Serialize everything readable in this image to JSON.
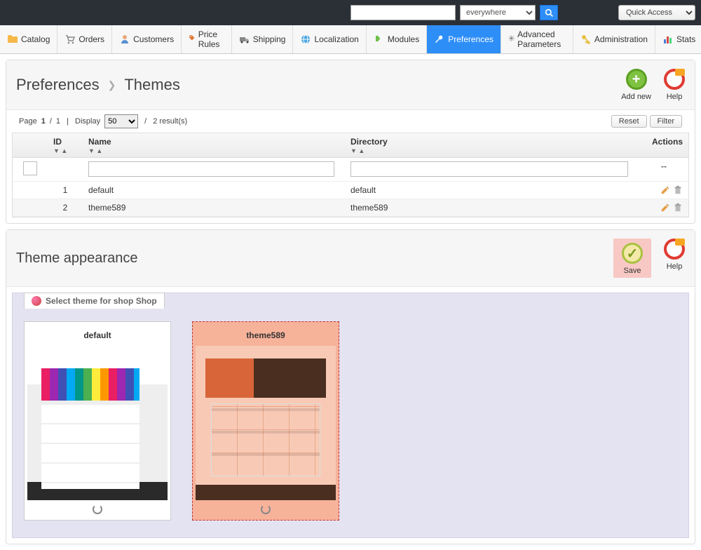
{
  "topbar": {
    "search_value": "",
    "scope_selected": "everywhere",
    "quick_access": "Quick Access"
  },
  "nav": {
    "items": [
      {
        "label": "Catalog"
      },
      {
        "label": "Orders"
      },
      {
        "label": "Customers"
      },
      {
        "label": "Price Rules"
      },
      {
        "label": "Shipping"
      },
      {
        "label": "Localization"
      },
      {
        "label": "Modules"
      },
      {
        "label": "Preferences"
      },
      {
        "label": "Advanced Parameters"
      },
      {
        "label": "Administration"
      },
      {
        "label": "Stats"
      }
    ],
    "active_index": 7
  },
  "breadcrumb": {
    "section": "Preferences",
    "page": "Themes"
  },
  "head_actions": {
    "add_new": "Add new",
    "help": "Help"
  },
  "pager": {
    "page_label": "Page",
    "page_current": "1",
    "page_total": "1",
    "display_label": "Display",
    "per_page": "50",
    "results_text": "2 result(s)",
    "reset": "Reset",
    "filter": "Filter"
  },
  "grid": {
    "columns": {
      "id": "ID",
      "name": "Name",
      "directory": "Directory",
      "actions": "Actions"
    },
    "filter_actions_placeholder": "--",
    "rows": [
      {
        "id": "1",
        "name": "default",
        "directory": "default"
      },
      {
        "id": "2",
        "name": "theme589",
        "directory": "theme589"
      }
    ]
  },
  "appearance": {
    "title": "Theme appearance",
    "save": "Save",
    "help": "Help",
    "select_legend": "Select theme for shop Shop",
    "themes": [
      {
        "name": "default",
        "selected": false
      },
      {
        "name": "theme589",
        "selected": true
      }
    ]
  }
}
